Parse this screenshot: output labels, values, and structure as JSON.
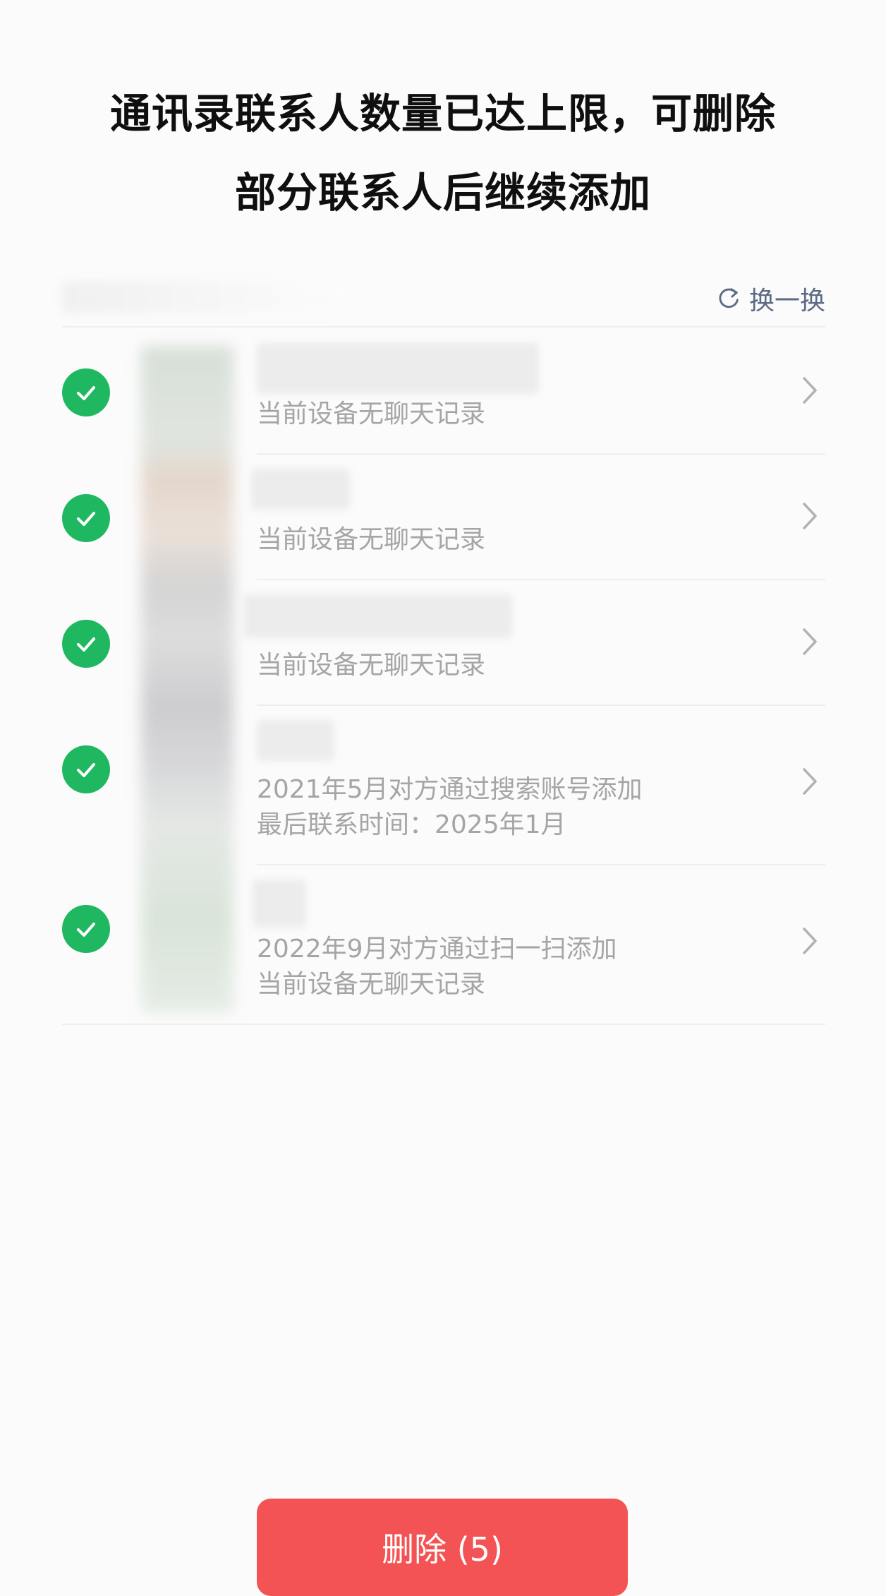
{
  "header": {
    "title_line1": "通讯录联系人数量已达上限，可删除",
    "title_line2": "部分联系人后继续添加"
  },
  "section": {
    "refresh_label": "换一换",
    "refresh_icon": "refresh-icon"
  },
  "contacts": [
    {
      "selected": true,
      "lines": [
        "当前设备无聊天记录"
      ]
    },
    {
      "selected": true,
      "lines": [
        "当前设备无聊天记录"
      ]
    },
    {
      "selected": true,
      "lines": [
        "当前设备无聊天记录"
      ]
    },
    {
      "selected": true,
      "lines": [
        "2021年5月对方通过搜索账号添加",
        "最后联系时间：2025年1月"
      ]
    },
    {
      "selected": true,
      "lines": [
        "2022年9月对方通过扫一扫添加",
        "当前设备无聊天记录"
      ]
    }
  ],
  "footer": {
    "delete_label": "删除 (5)"
  },
  "colors": {
    "accent_green": "#1fb861",
    "delete_red": "#f35354",
    "secondary_text": "#a5a5a5",
    "link_text": "#5d6a84"
  }
}
